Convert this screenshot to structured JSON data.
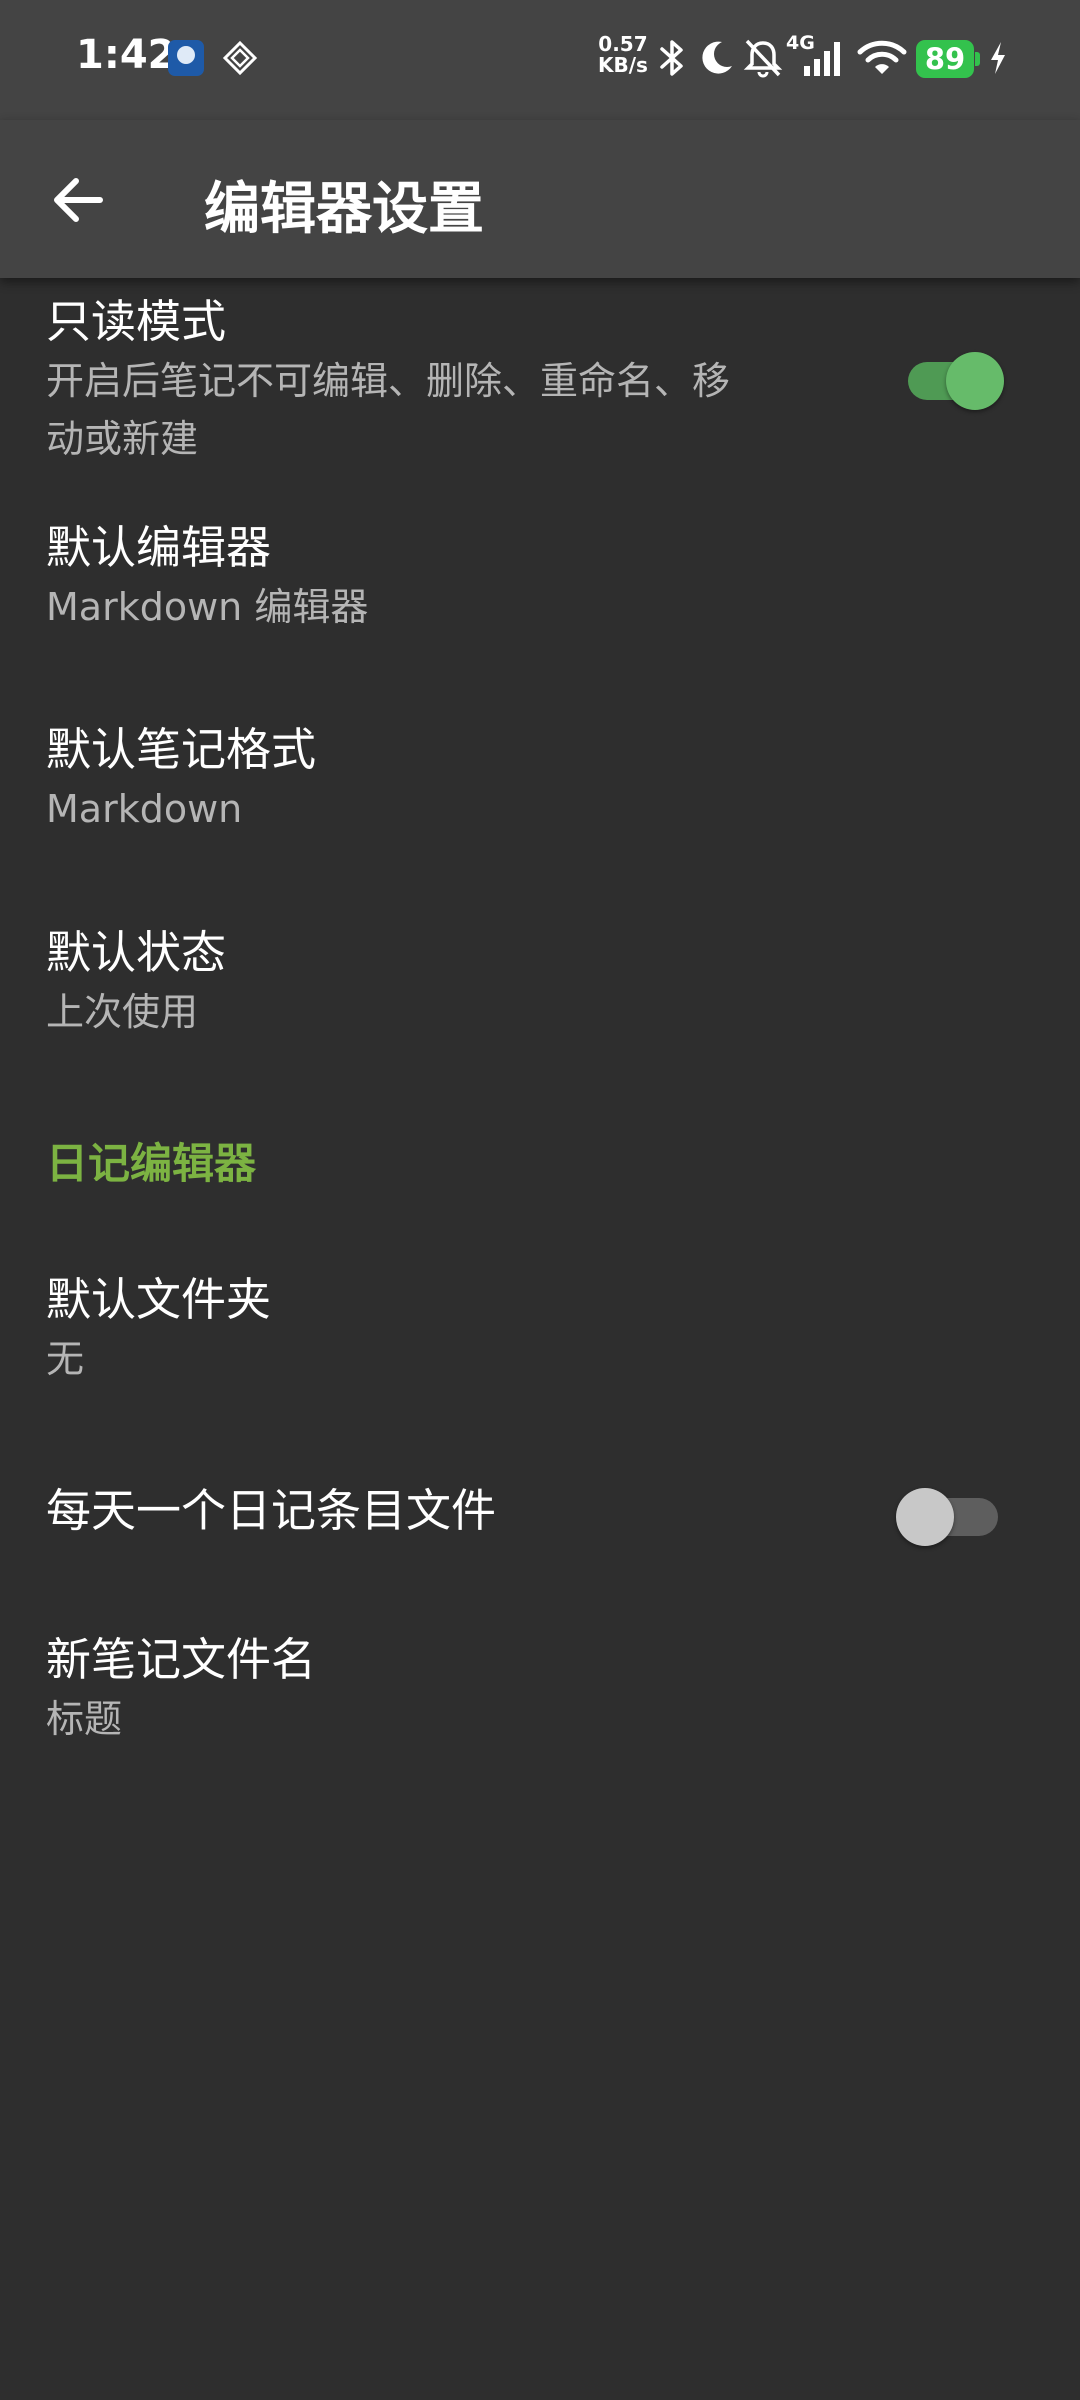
{
  "status_bar": {
    "time": "1:42",
    "net_speed_value": "0.57",
    "net_speed_unit": "KB/s",
    "network_type": "4G",
    "battery": "89",
    "icons": [
      "app-notification-icon",
      "app-diamond-icon",
      "bluetooth-icon",
      "moon-icon",
      "bell-off-icon",
      "signal-icon",
      "wifi-icon",
      "battery-icon",
      "charging-icon"
    ]
  },
  "app_bar": {
    "title": "编辑器设置",
    "back_icon": "arrow-back-icon"
  },
  "settings": {
    "read_only": {
      "title": "只读模式",
      "summary_line1": "开启后笔记不可编辑、删除、重命名、移",
      "summary_line2": "动或新建",
      "enabled": true
    },
    "default_editor": {
      "title": "默认编辑器",
      "value": "Markdown 编辑器"
    },
    "default_note_format": {
      "title": "默认笔记格式",
      "value": "Markdown"
    },
    "default_state": {
      "title": "默认状态",
      "value": "上次使用"
    },
    "diary_section_header": "日记编辑器",
    "default_folder": {
      "title": "默认文件夹",
      "value": "无"
    },
    "one_entry_per_day": {
      "title": "每天一个日记条目文件",
      "enabled": false
    },
    "new_note_filename": {
      "title": "新笔记文件名",
      "value": "标题"
    }
  },
  "colors": {
    "background": "#2e2e2e",
    "app_bar": "#444444",
    "accent_green": "#66bb6a",
    "section_header_green": "#7cb342",
    "battery_green": "#33c24d",
    "secondary_text": "#b5b5b5"
  }
}
